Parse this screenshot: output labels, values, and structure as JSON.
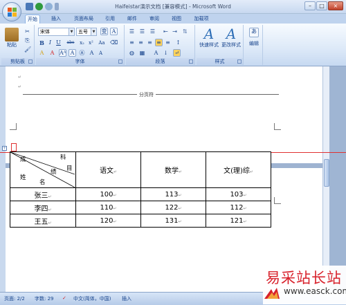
{
  "window": {
    "title": "Haifeistar演示文档 [兼容模式] - Microsoft Word",
    "controls": [
      "–",
      "□",
      "×"
    ]
  },
  "ribbon": {
    "tabs": [
      "开始",
      "插入",
      "页面布局",
      "引用",
      "邮件",
      "审阅",
      "视图",
      "加载项"
    ],
    "active_tab": "开始",
    "clipboard": {
      "paste_label": "粘贴",
      "group_label": "剪贴板"
    },
    "font": {
      "font_name": "宋体",
      "font_size": "五号",
      "group_label": "字体",
      "buttons": [
        "B",
        "I",
        "U",
        "abe",
        "x₂",
        "x²",
        "Aa",
        "A",
        "A",
        "Aᴬ",
        "A",
        "Ⓐ",
        "A",
        "A"
      ]
    },
    "paragraph": {
      "group_label": "段落"
    },
    "styles": {
      "quick_styles_label": "快速样式",
      "change_styles_label": "更改样式",
      "group_label": "样式"
    },
    "editing": {
      "edit_label": "编辑"
    }
  },
  "document": {
    "page_break_label": "分页符",
    "table": {
      "diagonal_header": {
        "cheng": "成",
        "ke": "科",
        "mu": "目",
        "ji": "绩",
        "xing": "姓",
        "ming": "名"
      },
      "columns": [
        "语文",
        "数学",
        "文(理)综"
      ],
      "rows": [
        {
          "name": "张三",
          "values": [
            "100",
            "113",
            "103"
          ]
        },
        {
          "name": "李四",
          "values": [
            "110",
            "122",
            "112"
          ]
        },
        {
          "name": "王五",
          "values": [
            "120",
            "131",
            "121"
          ]
        }
      ]
    }
  },
  "statusbar": {
    "page": "页面: 2/2",
    "words": "字数: 29",
    "language": "中文(简体，中国)",
    "mode": "插入"
  },
  "watermark": {
    "cn": "易采站长站",
    "en": "www.easck.com"
  },
  "colors": {
    "ribbon_bg": "#dde9f8",
    "accent": "#15428b",
    "red_line": "#e03030",
    "watermark_red": "#d8212b"
  }
}
